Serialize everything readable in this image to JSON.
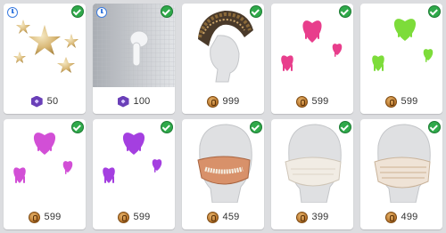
{
  "colors": {
    "background": "#dcdde0",
    "owned_check": "#2fa94a",
    "limited_clock": "#3d7de0",
    "coin": "#b5722a",
    "gem": "#6a3fb8"
  },
  "items": [
    {
      "name": "gold-stars",
      "currency_icon": "gem-icon",
      "price": "50",
      "owned": true,
      "limited": true
    },
    {
      "name": "white-earbud",
      "currency_icon": "gem-icon",
      "price": "100",
      "owned": true,
      "limited": true
    },
    {
      "name": "spiked-mohawk",
      "currency_icon": "coin-icon",
      "price": "999",
      "owned": true,
      "limited": false
    },
    {
      "name": "pink-dripping-hearts",
      "currency_icon": "coin-icon",
      "price": "599",
      "owned": true,
      "limited": false
    },
    {
      "name": "green-dripping-hearts",
      "currency_icon": "coin-icon",
      "price": "599",
      "owned": true,
      "limited": false
    },
    {
      "name": "magenta-dripping-hearts",
      "currency_icon": "coin-icon",
      "price": "599",
      "owned": true,
      "limited": false
    },
    {
      "name": "purple-dripping-hearts",
      "currency_icon": "coin-icon",
      "price": "599",
      "owned": true,
      "limited": false
    },
    {
      "name": "teeth-face-mask",
      "currency_icon": "coin-icon",
      "price": "459",
      "owned": true,
      "limited": false
    },
    {
      "name": "white-face-mask",
      "currency_icon": "coin-icon",
      "price": "399",
      "owned": true,
      "limited": false
    },
    {
      "name": "pleated-face-mask",
      "currency_icon": "coin-icon",
      "price": "499",
      "owned": true,
      "limited": false
    }
  ]
}
